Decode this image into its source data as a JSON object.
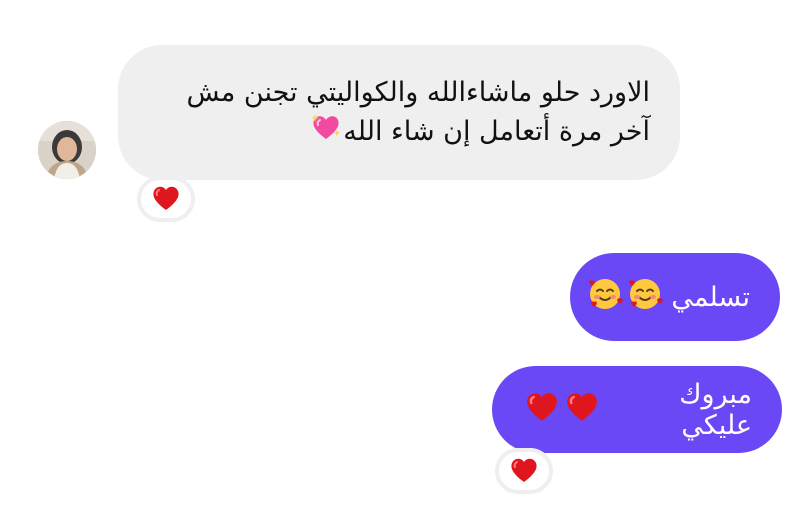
{
  "conversation": {
    "incoming_message": {
      "line1": "الاورد حلو ماشاءالله والكواليتي  تجنن مش",
      "line2": "آخر مرة أتعامل إن شاء الله",
      "emoji": "sparkling-heart",
      "reaction": "red-heart"
    },
    "outgoing_messages": [
      {
        "text": "تسلمي",
        "emoji": [
          "smiling-face-with-hearts",
          "smiling-face-with-hearts"
        ]
      },
      {
        "text": "مبروك عليكي",
        "emoji": [
          "red-heart",
          "red-heart"
        ],
        "reaction": "red-heart"
      }
    ]
  },
  "colors": {
    "incoming_bubble": "#efefef",
    "outgoing_bubble": "#6a48f5",
    "heart": "#e0161f"
  }
}
